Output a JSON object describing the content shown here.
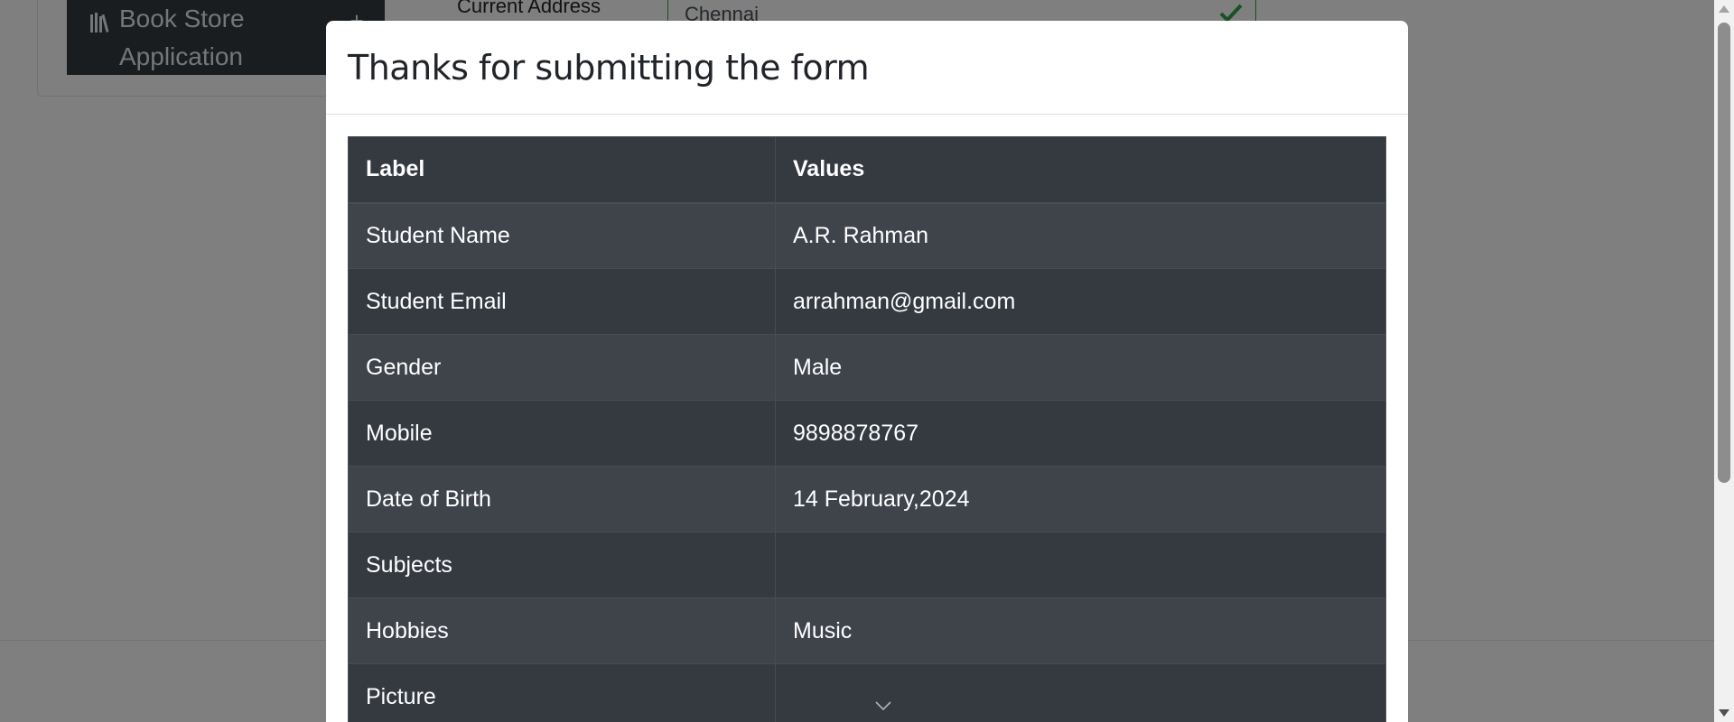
{
  "background": {
    "sidebar_group_label": "Book Store Application",
    "sidebar_expander": "+",
    "address_label": "Current Address",
    "address_value": "Chennai"
  },
  "modal": {
    "title": "Thanks for submitting the form",
    "table": {
      "headers": [
        "Label",
        "Values"
      ],
      "rows": [
        {
          "label": "Student Name",
          "value": "A.R. Rahman"
        },
        {
          "label": "Student Email",
          "value": "arrahman@gmail.com"
        },
        {
          "label": "Gender",
          "value": "Male"
        },
        {
          "label": "Mobile",
          "value": "9898878767"
        },
        {
          "label": "Date of Birth",
          "value": "14 February,2024"
        },
        {
          "label": "Subjects",
          "value": ""
        },
        {
          "label": "Hobbies",
          "value": "Music"
        },
        {
          "label": "Picture",
          "value": ""
        }
      ]
    }
  },
  "icons": {
    "books": "books-icon",
    "check": "check-icon",
    "chevron": "chevron-down-icon"
  },
  "colors": {
    "table_dark": "#343a40",
    "table_stripe": "#3f444b",
    "valid_green": "#28a745"
  }
}
